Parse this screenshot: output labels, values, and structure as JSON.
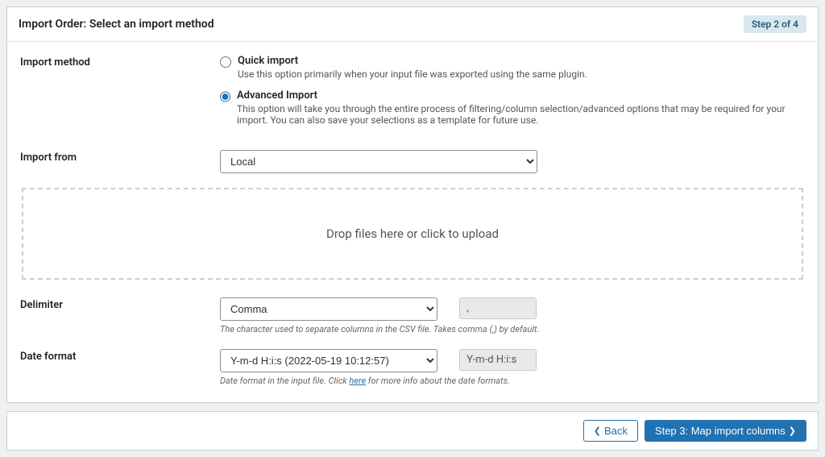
{
  "header": {
    "title": "Import Order: Select an import method",
    "step_badge": "Step 2 of 4"
  },
  "import_method": {
    "label": "Import method",
    "quick": {
      "title": "Quick import",
      "desc": "Use this option primarily when your input file was exported using the same plugin."
    },
    "advanced": {
      "title": "Advanced Import",
      "desc": "This option will take you through the entire process of filtering/column selection/advanced options that may be required for your import. You can also save your selections as a template for future use."
    }
  },
  "import_from": {
    "label": "Import from",
    "value": "Local"
  },
  "dropzone": {
    "text": "Drop files here or click to upload"
  },
  "delimiter": {
    "label": "Delimiter",
    "value": "Comma",
    "chip": ",",
    "help": "The character used to separate columns in the CSV file. Takes comma (,) by default."
  },
  "date_format": {
    "label": "Date format",
    "value": "Y-m-d H:i:s (2022-05-19 10:12:57)",
    "chip": "Y-m-d H:i:s",
    "help_pre": "Date format in the input file. Click ",
    "help_link": "here",
    "help_post": " for more info about the date formats."
  },
  "footer": {
    "back": "Back",
    "next": "Step 3: Map import columns"
  }
}
